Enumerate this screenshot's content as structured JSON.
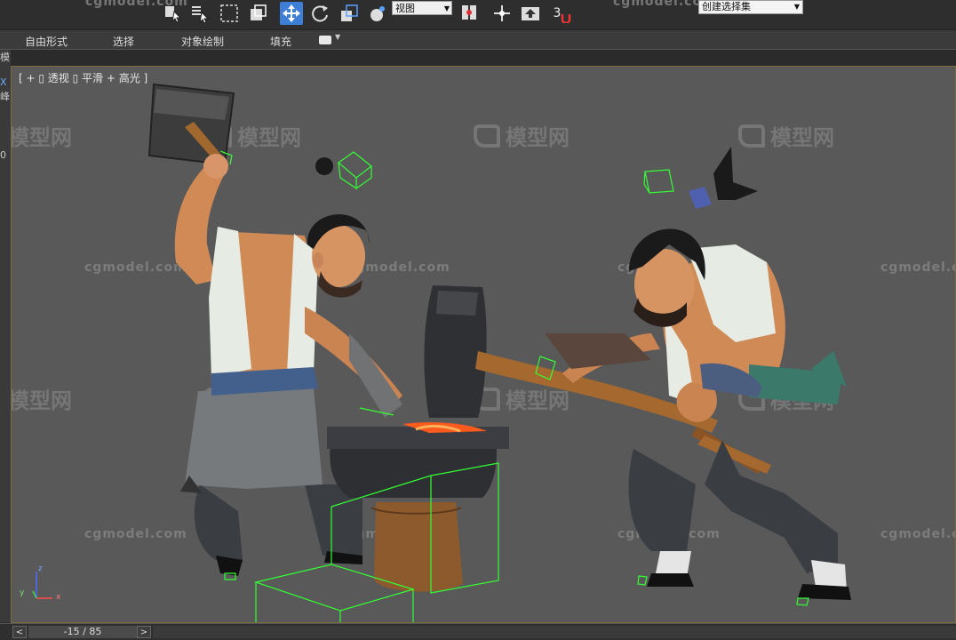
{
  "toolbar": {
    "view_dropdown": "视图",
    "selection_set": "创建选择集",
    "snap_number": "3",
    "watermark_left": "cgmodel.com",
    "watermark_right": "cgmodel.com"
  },
  "ribbon": {
    "tabs": [
      "自由形式",
      "选择",
      "对象绘制",
      "填充"
    ]
  },
  "left_strip": {
    "chars": [
      "模",
      "X",
      "峰",
      "0"
    ]
  },
  "viewport": {
    "label": "[ + ▯ 透视 ▯ 平滑 + 高光 ]",
    "watermark_text": "cgmodel.com",
    "watermark_logo": "模型网",
    "axis": {
      "x": "x",
      "y": "y",
      "z": "z"
    }
  },
  "timeline": {
    "frame": "-15 / 85",
    "prev": "<",
    "next": ">"
  },
  "colors": {
    "accent_blue": "#3d7fd6",
    "viewport_bg": "#595959",
    "border_gold": "#7a6b3e",
    "bbox_green": "#33ff33"
  }
}
